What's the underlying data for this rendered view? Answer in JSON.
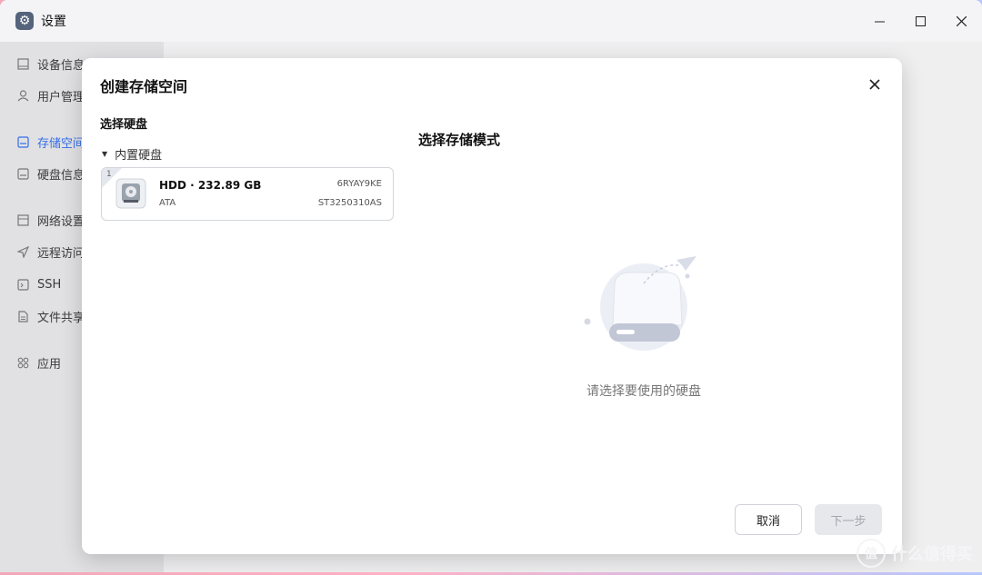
{
  "window": {
    "title": "设置",
    "controls": {
      "minimize": "—",
      "maximize": "☐",
      "close": "✕"
    }
  },
  "sidebar": {
    "items": [
      {
        "label": "设备信息",
        "icon": "device-icon"
      },
      {
        "label": "用户管理",
        "icon": "user-icon"
      },
      {
        "label": "存储空间",
        "icon": "storage-icon",
        "active": true
      },
      {
        "label": "硬盘信息",
        "icon": "disk-icon"
      },
      {
        "label": "网络设置",
        "icon": "network-icon"
      },
      {
        "label": "远程访问",
        "icon": "remote-icon"
      },
      {
        "label": "SSH",
        "icon": "terminal-icon"
      },
      {
        "label": "文件共享",
        "icon": "file-icon"
      },
      {
        "label": "应用",
        "icon": "apps-icon"
      }
    ]
  },
  "dialog": {
    "title": "创建存储空间",
    "close": "×",
    "select_disk_title": "选择硬盘",
    "group_title": "内置硬盘",
    "disk": {
      "slot": "1",
      "name": "HDD · 232.89 GB",
      "interface": "ATA",
      "serial": "6RYAY9KE",
      "model": "ST3250310AS"
    },
    "mode_title": "选择存储模式",
    "empty_text": "请选择要使用的硬盘",
    "cancel_label": "取消",
    "next_label": "下一步"
  },
  "watermark": {
    "text": "什么值得买",
    "icon": "值"
  },
  "colors": {
    "accent": "#2c6cf6",
    "background_gradient": [
      "#f3a7b8",
      "#b7c6ff"
    ]
  }
}
